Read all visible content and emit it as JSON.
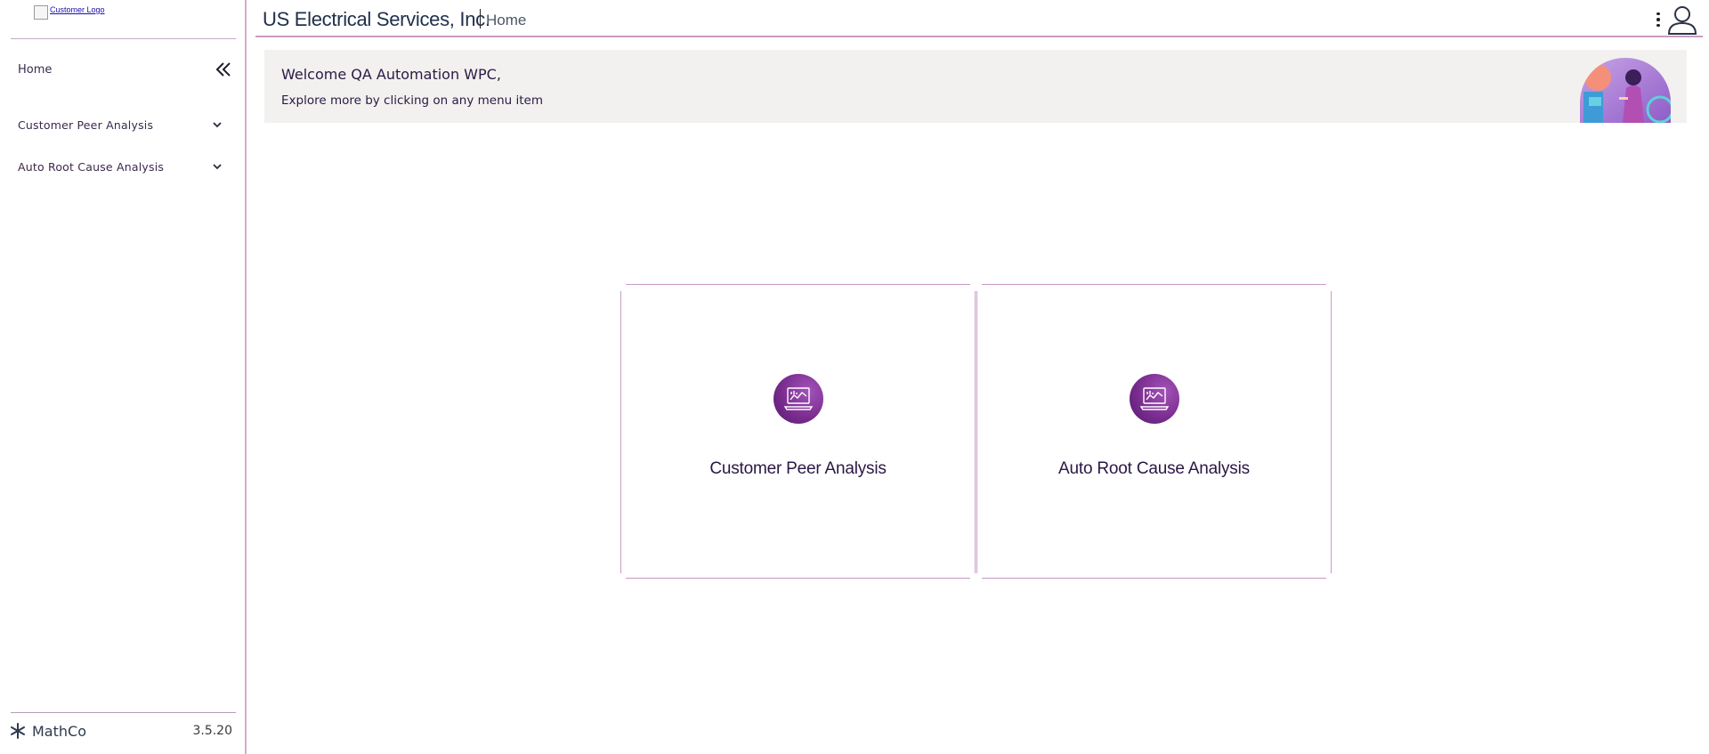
{
  "sidebar": {
    "logo_alt": "Customer Logo",
    "home_label": "Home",
    "items": [
      {
        "label": "Customer Peer Analysis"
      },
      {
        "label": "Auto Root Cause Analysis"
      }
    ],
    "brand": "MathCo",
    "version": "3.5.20"
  },
  "header": {
    "company": "US Electrical Services, Inc.",
    "breadcrumb": "Home"
  },
  "banner": {
    "title": "Welcome QA Automation WPC,",
    "subtitle": "Explore more by clicking on any menu item"
  },
  "cards": [
    {
      "label": "Customer Peer Analysis",
      "icon": "laptop-chart-icon"
    },
    {
      "label": "Auto Root Cause Analysis",
      "icon": "laptop-chart-icon"
    }
  ],
  "colors": {
    "accent_border": "#c89ac5",
    "icon_purple": "#7b2d90",
    "banner_bg": "#f2f1ef"
  }
}
